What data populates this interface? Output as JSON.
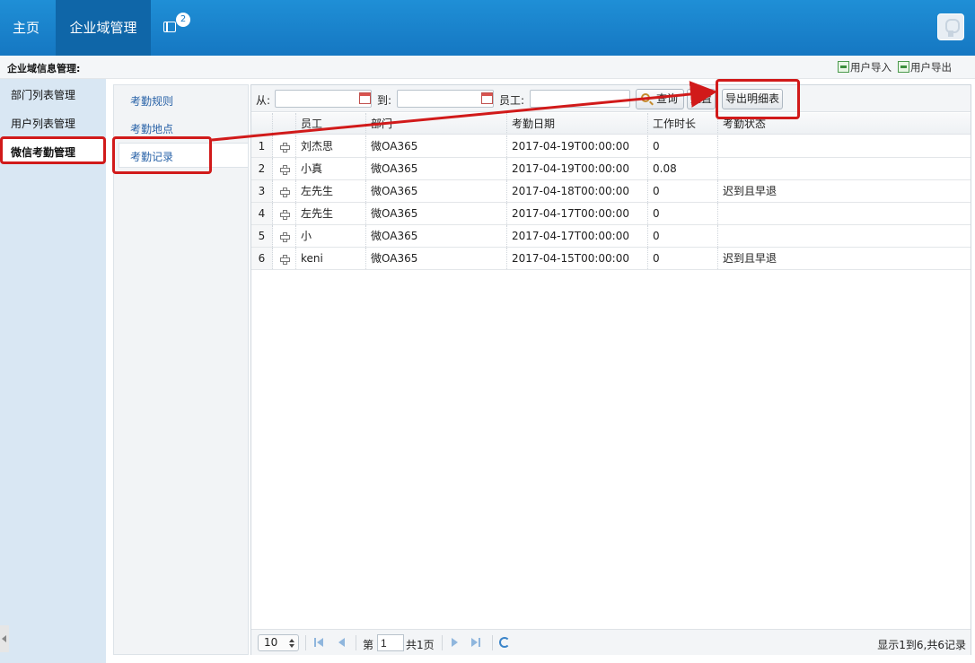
{
  "topnav": {
    "home": "主页",
    "enterprise": "企业域管理",
    "badge_count": "2"
  },
  "header": {
    "title": "企业域信息管理:",
    "import_label": "用户导入",
    "export_label": "用户导出"
  },
  "sidebar": {
    "items": [
      {
        "label": "部门列表管理"
      },
      {
        "label": "用户列表管理"
      },
      {
        "label": "微信考勤管理"
      }
    ]
  },
  "tabs": {
    "items": [
      {
        "label": "考勤规则"
      },
      {
        "label": "考勤地点"
      },
      {
        "label": "考勤记录"
      }
    ]
  },
  "toolbar": {
    "from_label": "从:",
    "to_label": "到:",
    "employee_label": "员工:",
    "query_label": "查询",
    "reset_label": "重置",
    "export_detail_label": "导出明细表"
  },
  "grid": {
    "columns": {
      "employee": "员工",
      "department": "部门",
      "date": "考勤日期",
      "hours": "工作时长",
      "status": "考勤状态"
    },
    "rows": [
      {
        "num": "1",
        "employee": "刘杰思",
        "department": "微OA365",
        "date": "2017-04-19T00:00:00",
        "hours": "0",
        "status": ""
      },
      {
        "num": "2",
        "employee": "小真",
        "department": "微OA365",
        "date": "2017-04-19T00:00:00",
        "hours": "0.08",
        "status": ""
      },
      {
        "num": "3",
        "employee": "左先生",
        "department": "微OA365",
        "date": "2017-04-18T00:00:00",
        "hours": "0",
        "status": "迟到且早退"
      },
      {
        "num": "4",
        "employee": "左先生",
        "department": "微OA365",
        "date": "2017-04-17T00:00:00",
        "hours": "0",
        "status": ""
      },
      {
        "num": "5",
        "employee": "小",
        "department": "微OA365",
        "date": "2017-04-17T00:00:00",
        "hours": "0",
        "status": ""
      },
      {
        "num": "6",
        "employee": "keni",
        "department": "微OA365",
        "date": "2017-04-15T00:00:00",
        "hours": "0",
        "status": "迟到且早退"
      }
    ]
  },
  "pager": {
    "page_size": "10",
    "page_prefix": "第",
    "page_value": "1",
    "page_suffix": "共1页",
    "info": "显示1到6,共6记录"
  },
  "colors": {
    "topbar": "#1577c2",
    "highlight": "#d11a1a",
    "sidebar": "#d9e7f3"
  }
}
